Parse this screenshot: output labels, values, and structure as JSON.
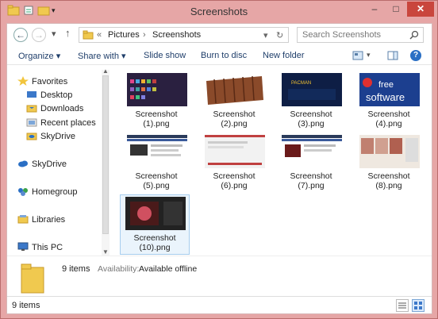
{
  "window": {
    "title": "Screenshots"
  },
  "title_buttons": {
    "minimize": "–",
    "maximize": "□",
    "close": "✕"
  },
  "address_bar": {
    "back": "←",
    "forward": "→",
    "recent": "▾",
    "up": "↑",
    "overflow": "«",
    "crumb_pictures": "Pictures",
    "crumb_sep": "›",
    "crumb_current": "Screenshots",
    "dropdown": "▾",
    "refresh": "↻"
  },
  "search": {
    "placeholder": "Search Screenshots"
  },
  "commands": {
    "organize": "Organize ▾",
    "share_with": "Share with ▾",
    "slide_show": "Slide show",
    "burn_to_disc": "Burn to disc",
    "new_folder": "New folder",
    "help": "?"
  },
  "nav": {
    "favorites": "Favorites",
    "desktop": "Desktop",
    "downloads": "Downloads",
    "recent_places": "Recent places",
    "skydrive_fav": "SkyDrive",
    "skydrive": "SkyDrive",
    "homegroup": "Homegroup",
    "libraries": "Libraries",
    "this_pc": "This PC"
  },
  "files": [
    {
      "line1": "Screenshot",
      "line2": "(1).png",
      "thumb_color": "#2a2040"
    },
    {
      "line1": "Screenshot",
      "line2": "(2).png",
      "thumb_color": "#8a4a2a"
    },
    {
      "line1": "Screenshot",
      "line2": "(3).png",
      "thumb_color": "#0e1e45"
    },
    {
      "line1": "Screenshot",
      "line2": "(4).png",
      "thumb_color": "#1c3f8f"
    },
    {
      "line1": "Screenshot",
      "line2": "(5).png",
      "thumb_color": "#2a3a5a"
    },
    {
      "line1": "Screenshot",
      "line2": "(6).png",
      "thumb_color": "#f2f2f2"
    },
    {
      "line1": "Screenshot",
      "line2": "(7).png",
      "thumb_color": "#6a1a1a"
    },
    {
      "line1": "Screenshot",
      "line2": "(8).png",
      "thumb_color": "#efe8e0"
    },
    {
      "line1": "Screenshot",
      "line2": "(10).png",
      "thumb_color": "#4a1a1a"
    }
  ],
  "thumb_text": {
    "freesoftware_1": "free",
    "freesoftware_2": "software",
    "pacman": "PACMAN"
  },
  "details": {
    "count": "9 items",
    "availability_label": "Availability:",
    "availability_value": "Available offline"
  },
  "status": {
    "count": "9 items"
  }
}
